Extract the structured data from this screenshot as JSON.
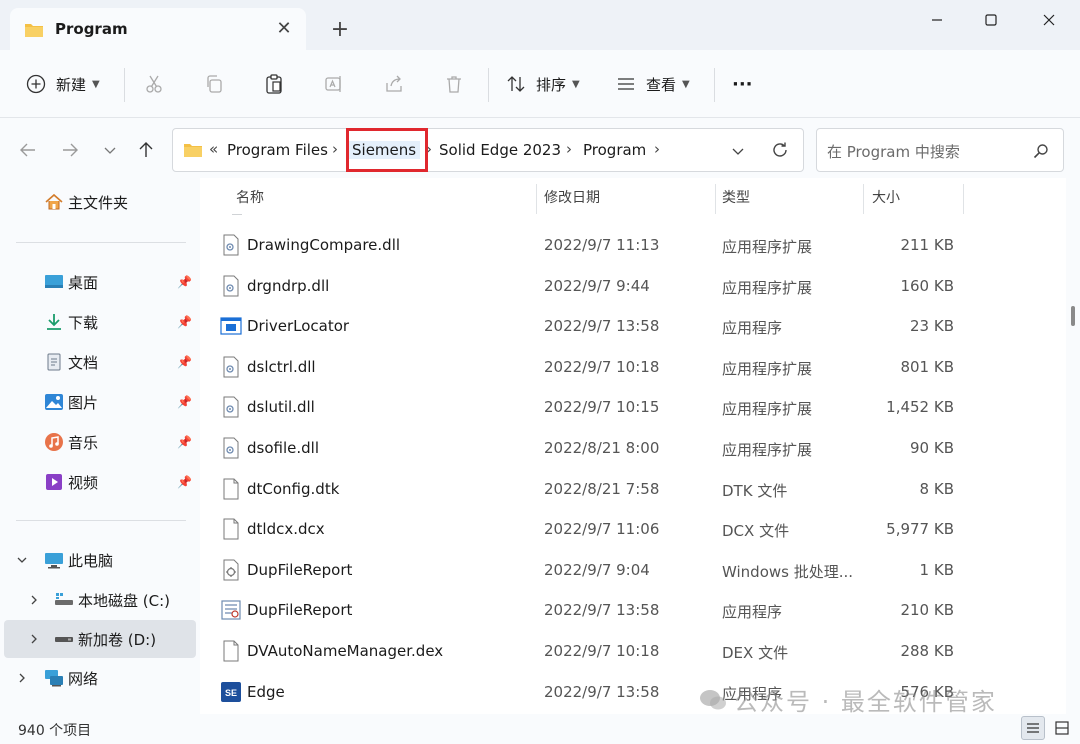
{
  "window": {
    "tab_title": "Program",
    "new_tab": "+",
    "tab_close": "✕"
  },
  "toolbar": {
    "new_label": "新建",
    "sort_label": "排序",
    "view_label": "查看",
    "more_label": "···"
  },
  "address": {
    "overflow": "«",
    "crumbs": [
      "Program Files",
      "Siemens",
      "Solid Edge 2023",
      "Program"
    ],
    "sep": "›"
  },
  "search": {
    "placeholder": "在 Program 中搜索"
  },
  "sidebar": {
    "home": "主文件夹",
    "quick": [
      {
        "label": "桌面"
      },
      {
        "label": "下载"
      },
      {
        "label": "文档"
      },
      {
        "label": "图片"
      },
      {
        "label": "音乐"
      },
      {
        "label": "视频"
      }
    ],
    "this_pc": "此电脑",
    "drive_c": "本地磁盘 (C:)",
    "drive_d": "新加卷 (D:)",
    "network": "网络"
  },
  "columns": {
    "name": "名称",
    "date": "修改日期",
    "type": "类型",
    "size": "大小"
  },
  "files": [
    {
      "name": "DrawingCompare.dll",
      "date": "2022/9/7 11:13",
      "type": "应用程序扩展",
      "size": "211 KB",
      "icon": "dll-icon"
    },
    {
      "name": "drgndrp.dll",
      "date": "2022/9/7 9:44",
      "type": "应用程序扩展",
      "size": "160 KB",
      "icon": "dll-icon"
    },
    {
      "name": "DriverLocator",
      "date": "2022/9/7 13:58",
      "type": "应用程序",
      "size": "23 KB",
      "icon": "app-icon"
    },
    {
      "name": "dslctrl.dll",
      "date": "2022/9/7 10:18",
      "type": "应用程序扩展",
      "size": "801 KB",
      "icon": "dll-icon"
    },
    {
      "name": "dslutil.dll",
      "date": "2022/9/7 10:15",
      "type": "应用程序扩展",
      "size": "1,452 KB",
      "icon": "dll-icon"
    },
    {
      "name": "dsofile.dll",
      "date": "2022/8/21 8:00",
      "type": "应用程序扩展",
      "size": "90 KB",
      "icon": "dll-icon"
    },
    {
      "name": "dtConfig.dtk",
      "date": "2022/8/21 7:58",
      "type": "DTK 文件",
      "size": "8 KB",
      "icon": "file-icon"
    },
    {
      "name": "dtldcx.dcx",
      "date": "2022/9/7 11:06",
      "type": "DCX 文件",
      "size": "5,977 KB",
      "icon": "file-icon"
    },
    {
      "name": "DupFileReport",
      "date": "2022/9/7 9:04",
      "type": "Windows 批处理...",
      "size": "1 KB",
      "icon": "batch-icon"
    },
    {
      "name": "DupFileReport",
      "date": "2022/9/7 13:58",
      "type": "应用程序",
      "size": "210 KB",
      "icon": "report-app-icon"
    },
    {
      "name": "DVAutoNameManager.dex",
      "date": "2022/9/7 10:18",
      "type": "DEX 文件",
      "size": "288 KB",
      "icon": "file-icon"
    },
    {
      "name": "Edge",
      "date": "2022/9/7 13:58",
      "type": "应用程序",
      "size": "576 KB",
      "icon": "se-app-icon"
    }
  ],
  "se_badge": "SE",
  "status": {
    "count": "940 个项目"
  },
  "watermark": "公众号 · 最全软件管家",
  "colors": {
    "highlight": "#e0282e",
    "folder": "#f4c045",
    "accent": "#1a6fd6"
  }
}
